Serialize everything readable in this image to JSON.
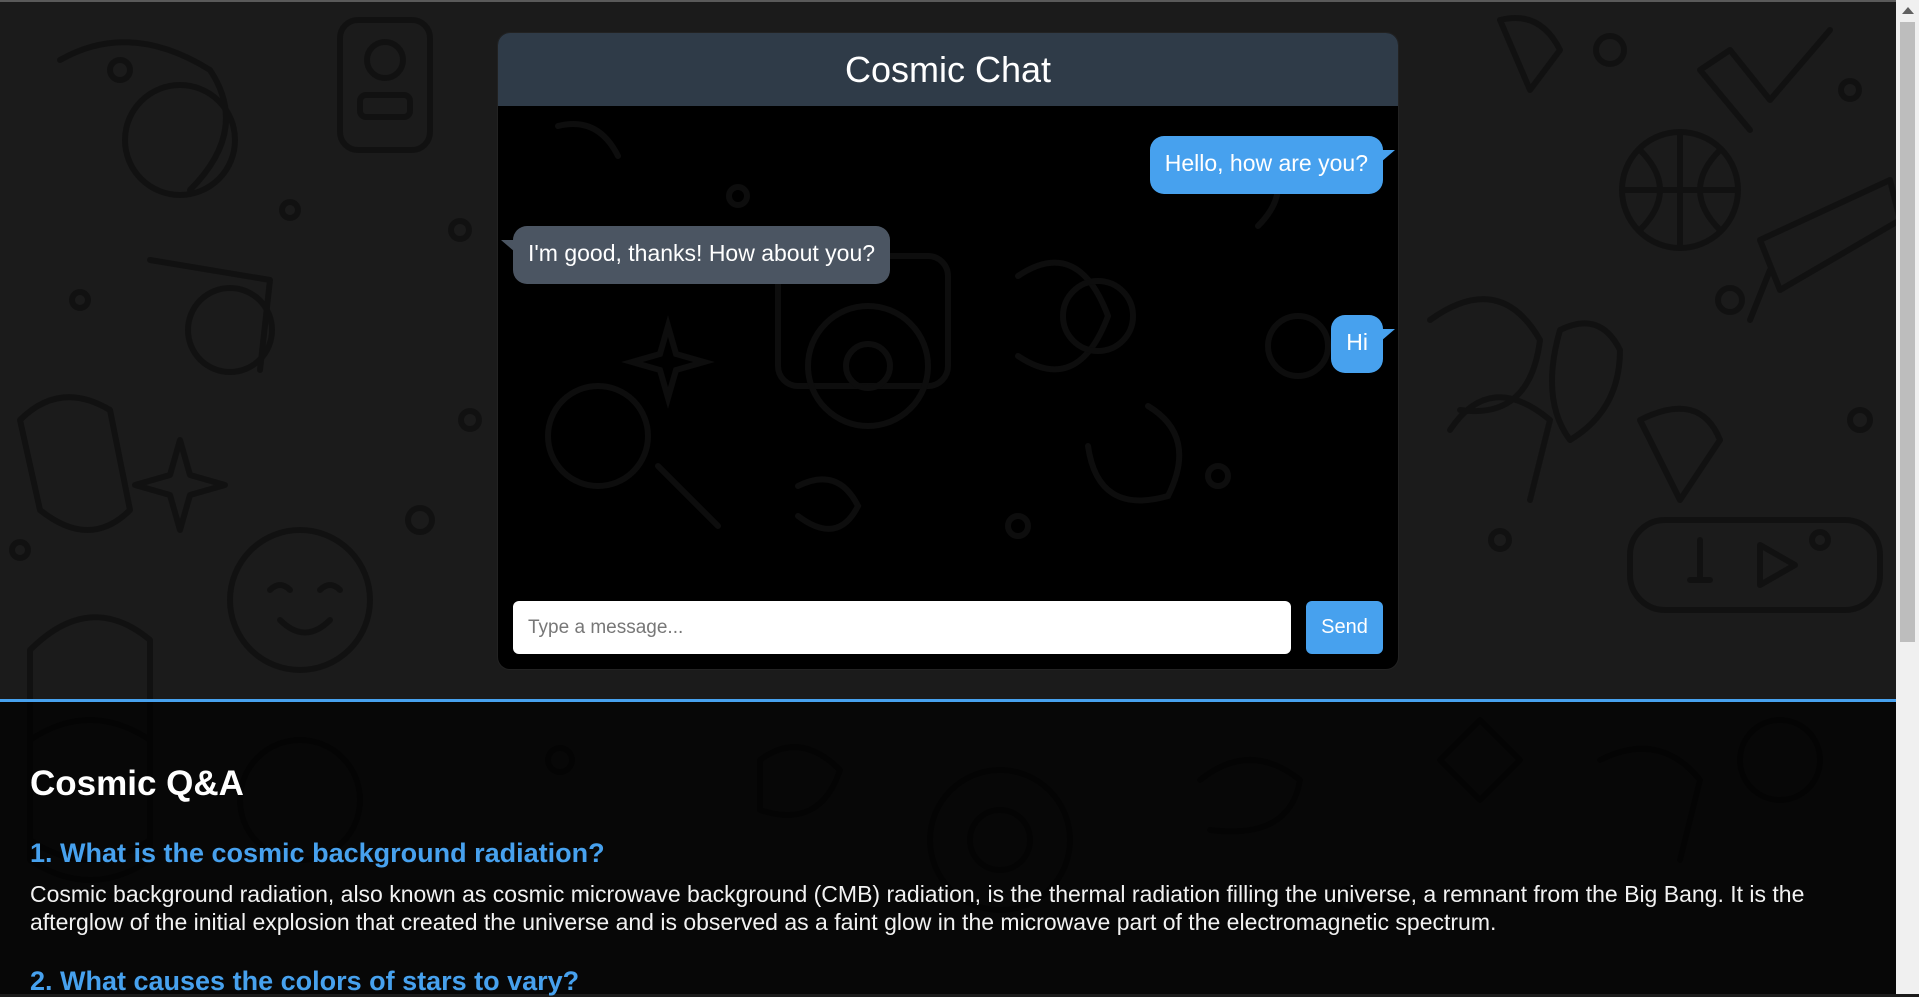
{
  "chat": {
    "title": "Cosmic Chat",
    "messages": [
      {
        "from": "user",
        "text": "Hello, how are you?"
      },
      {
        "from": "bot",
        "text": "I'm good, thanks! How about you?"
      },
      {
        "from": "user",
        "text": "Hi"
      }
    ],
    "input": {
      "placeholder": "Type a message...",
      "value": ""
    },
    "send_label": "Send"
  },
  "qa": {
    "title": "Cosmic Q&A",
    "items": [
      {
        "question": "1. What is the cosmic background radiation?",
        "answer": "Cosmic background radiation, also known as cosmic microwave background (CMB) radiation, is the thermal radiation filling the universe, a remnant from the Big Bang. It is the afterglow of the initial explosion that created the universe and is observed as a faint glow in the microwave part of the electromagnetic spectrum."
      },
      {
        "question": "2. What causes the colors of stars to vary?"
      }
    ]
  },
  "colors": {
    "accent": "#47a1ee",
    "header": "#2f3b48",
    "received_bubble": "#4b5562",
    "page_background": "#1b1b1b"
  }
}
